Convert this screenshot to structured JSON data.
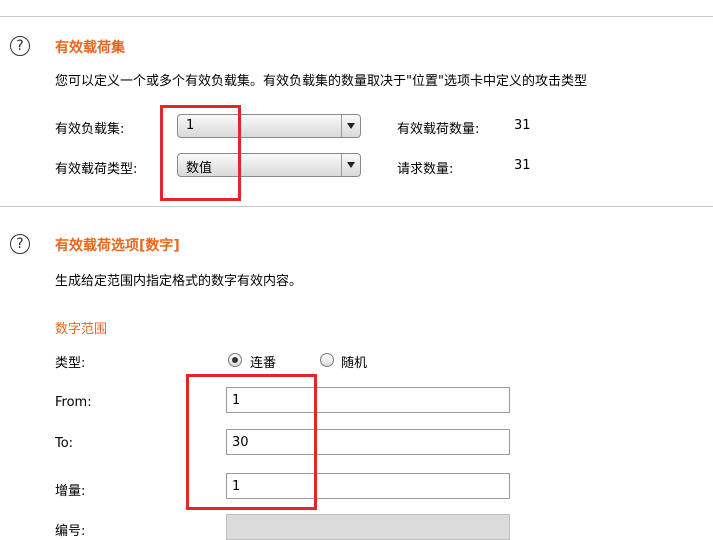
{
  "payload_sets": {
    "title": "有效载荷集",
    "description": "您可以定义一个或多个有效负载集。有效负载集的数量取决于\"位置\"选项卡中定义的攻击类型",
    "payload_set_label": "有效负载集:",
    "payload_set_value": "1",
    "payload_type_label": "有效载荷类型:",
    "payload_type_value": "数值",
    "payload_count_label": "有效载荷数量:",
    "payload_count_value": "31",
    "request_count_label": "请求数量:",
    "request_count_value": "31"
  },
  "payload_options": {
    "title": "有效载荷选项[数字]",
    "description": "生成给定范围内指定格式的数字有效内容。",
    "range_title": "数字范围",
    "type_label": "类型:",
    "radio_sequential": "连番",
    "radio_random": "随机",
    "from_label": "From:",
    "from_value": "1",
    "to_label": "To:",
    "to_value": "30",
    "step_label": "增量:",
    "step_value": "1",
    "how_many_label": "编号:"
  }
}
